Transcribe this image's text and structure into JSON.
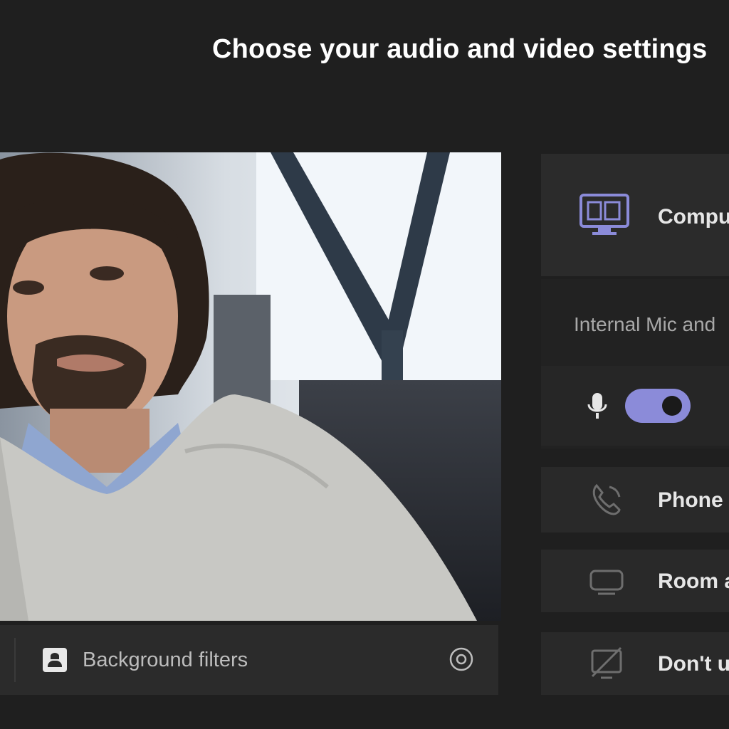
{
  "header": {
    "title": "Choose your audio and video settings"
  },
  "video_bar": {
    "background_filters_label": "Background filters"
  },
  "audio_options": {
    "computer_audio_label": "Compu",
    "device_label": "Internal Mic and",
    "mic_enabled": true,
    "phone_audio_label": "Phone",
    "room_audio_label": "Room a",
    "no_audio_label": "Don't u"
  },
  "colors": {
    "background": "#1f1f1f",
    "panel": "#2b2b2b",
    "accent": "#8b8bd9"
  },
  "icons": [
    "computer-audio-icon",
    "mic-icon",
    "phone-icon",
    "room-icon",
    "no-audio-icon",
    "background-filters-icon",
    "settings-icon"
  ]
}
